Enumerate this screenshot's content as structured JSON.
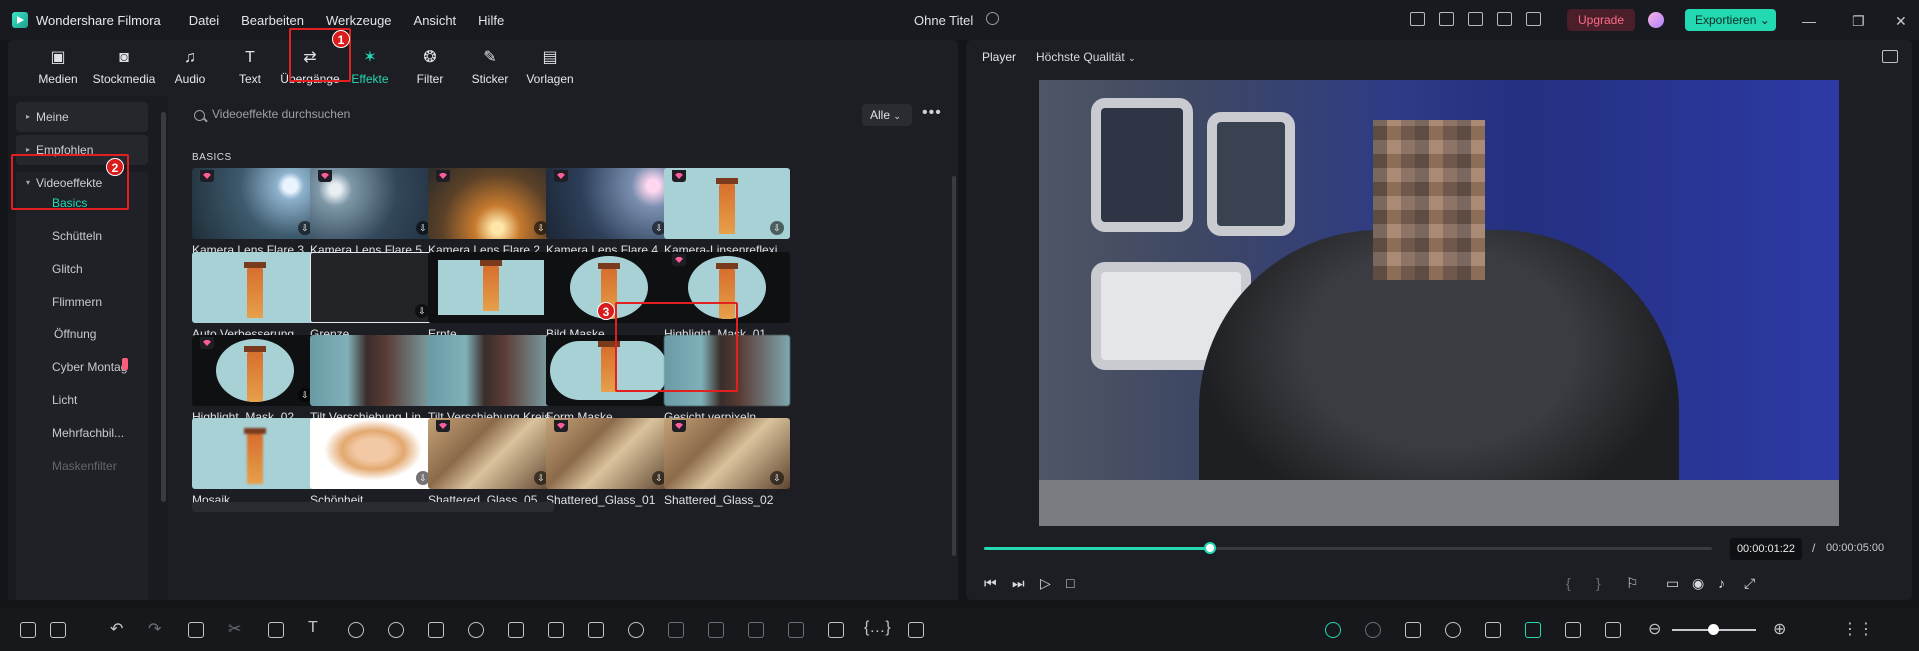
{
  "app": {
    "name": "Wondershare Filmora",
    "doc_title": "Ohne Titel"
  },
  "menu": [
    "Datei",
    "Bearbeiten",
    "Werkzeuge",
    "Ansicht",
    "Hilfe"
  ],
  "header": {
    "upgrade_label": "Upgrade",
    "export_label": "Exportieren"
  },
  "tabs": [
    {
      "label": "Medien",
      "icon": "media-icon"
    },
    {
      "label": "Stockmedia",
      "icon": "stock-media-icon"
    },
    {
      "label": "Audio",
      "icon": "audio-icon"
    },
    {
      "label": "Text",
      "icon": "text-icon"
    },
    {
      "label": "Übergänge",
      "icon": "transitions-icon"
    },
    {
      "label": "Effekte",
      "icon": "effects-icon"
    },
    {
      "label": "Filter",
      "icon": "filter-icon"
    },
    {
      "label": "Sticker",
      "icon": "sticker-icon"
    },
    {
      "label": "Vorlagen",
      "icon": "templates-icon"
    }
  ],
  "annotations": [
    "1",
    "2",
    "3"
  ],
  "sidebar": {
    "meine": "Meine",
    "empfohlen": "Empfohlen",
    "videoeffekte": "Videoeffekte",
    "items": [
      "Basics",
      "Schütteln",
      "Glitch",
      "Flimmern",
      "Öffnung",
      "Cyber Montag",
      "Licht",
      "Mehrfachbil...",
      "Maskenfilter"
    ]
  },
  "search": {
    "placeholder": "Videoeffekte durchsuchen",
    "filter_value": "Alle"
  },
  "section_title": "BASICS",
  "effects": [
    {
      "label": "Kamera Lens Flare 3",
      "premium": true
    },
    {
      "label": "Kamera Lens Flare 5",
      "premium": true
    },
    {
      "label": "Kamera Lens Flare 2",
      "premium": true
    },
    {
      "label": "Kamera Lens Flare 4",
      "premium": true
    },
    {
      "label": "Kamera-Linsenreflexio...",
      "premium": true
    },
    {
      "label": "Auto Verbesserung",
      "premium": false
    },
    {
      "label": "Grenze",
      "premium": false
    },
    {
      "label": "Ernte",
      "premium": false
    },
    {
      "label": "Bild Maske",
      "premium": false
    },
    {
      "label": "Highlight_Mask_01",
      "premium": true
    },
    {
      "label": "Highlight_Mask_02",
      "premium": true
    },
    {
      "label": "Tilt Verschiebung Linear",
      "premium": false
    },
    {
      "label": "Tilt Verschiebung Kreis",
      "premium": false
    },
    {
      "label": "Form Maske",
      "premium": false
    },
    {
      "label": "Gesicht verpixeln",
      "premium": false
    },
    {
      "label": "Mosaik",
      "premium": false
    },
    {
      "label": "Schönheit",
      "premium": false
    },
    {
      "label": "Shattered_Glass_05",
      "premium": true
    },
    {
      "label": "Shattered_Glass_01",
      "premium": true
    },
    {
      "label": "Shattered_Glass_02",
      "premium": true
    }
  ],
  "player": {
    "label": "Player",
    "quality": "Höchste Qualität",
    "current_time": "00:00:01:22",
    "separator": "/",
    "duration": "00:00:05:00",
    "progress": 0.31
  },
  "colors": {
    "accent": "#23d9b2",
    "upgrade": "#ff6b88",
    "annotation": "#e32020"
  }
}
